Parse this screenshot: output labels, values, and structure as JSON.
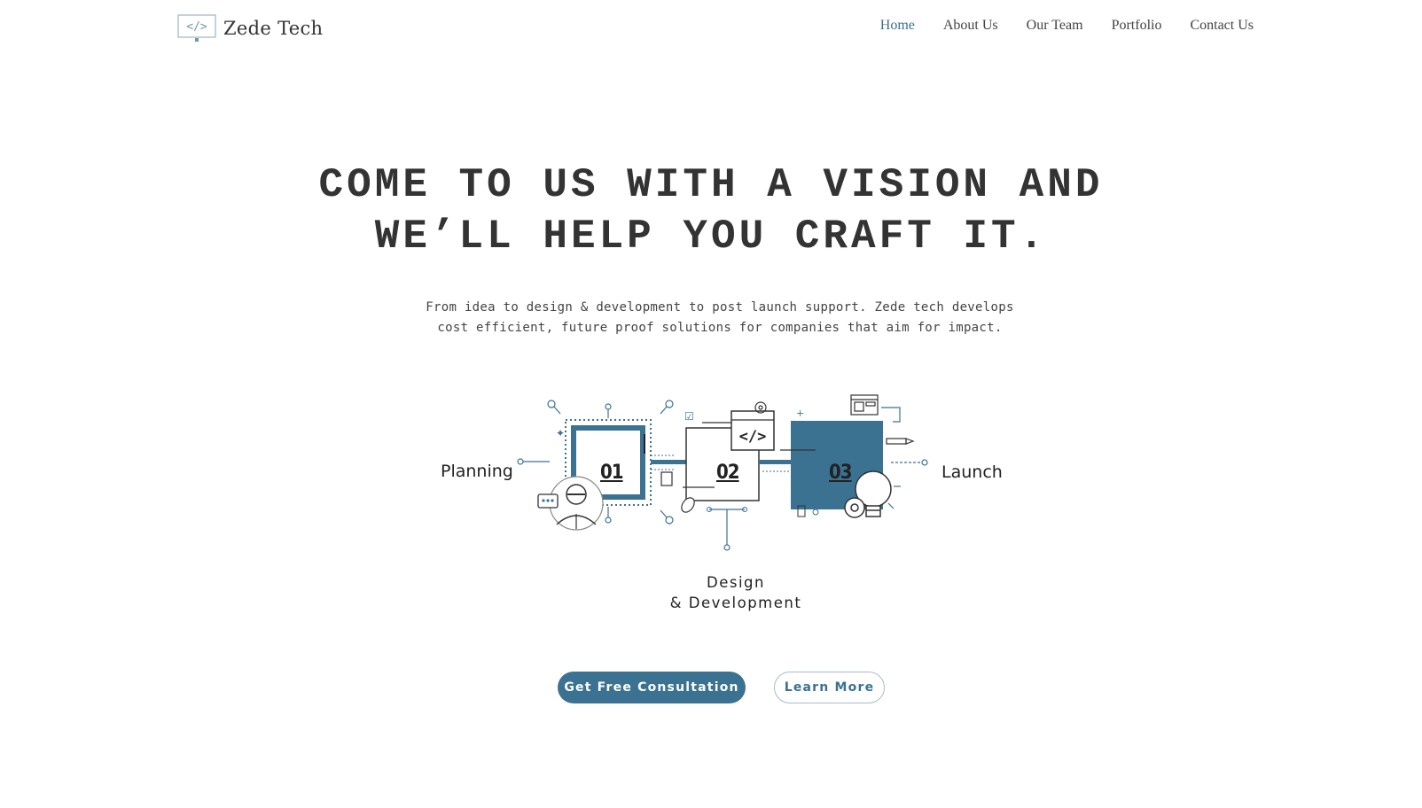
{
  "brand": {
    "name": "Zede Tech",
    "logo_icon": "code-monitor-icon",
    "accent_color": "#3b7191"
  },
  "nav": {
    "items": [
      {
        "label": "Home",
        "active": true
      },
      {
        "label": "About Us",
        "active": false
      },
      {
        "label": "Our Team",
        "active": false
      },
      {
        "label": "Portfolio",
        "active": false
      },
      {
        "label": "Contact Us",
        "active": false
      }
    ]
  },
  "hero": {
    "headline_line1": "COME TO US WITH A VISION AND",
    "headline_line2": "WE’LL HELP YOU CRAFT IT.",
    "subtitle": "From idea to design & development to post launch support. Zede tech develops cost efficient, future proof solutions for companies that aim for impact."
  },
  "process": {
    "steps": [
      {
        "number": "01",
        "label": "Planning"
      },
      {
        "number": "02",
        "label_line1": "Design",
        "label_line2": "& Development"
      },
      {
        "number": "03",
        "label": "Launch"
      }
    ],
    "icons": [
      "person-icon",
      "chat-bubble-icon",
      "code-window-icon",
      "gear-icon",
      "lightbulb-icon",
      "browser-layout-icon",
      "pen-icon"
    ]
  },
  "cta": {
    "primary_label": "Get Free Consultation",
    "secondary_label": "Learn More"
  }
}
